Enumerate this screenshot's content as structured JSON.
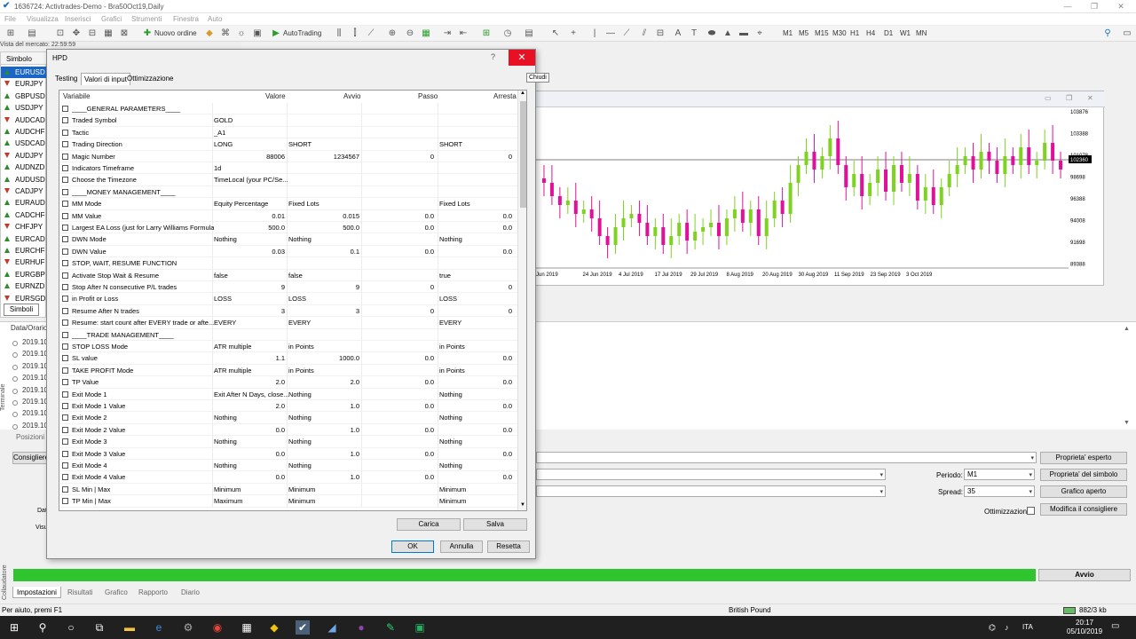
{
  "window": {
    "title": "1636724: Activtrades-Demo - Bra50Oct19,Daily"
  },
  "menu": [
    "File",
    "Visualizza",
    "Inserisci",
    "Grafici",
    "Strumenti",
    "Finestra",
    "Auto"
  ],
  "toolbar": {
    "new_order": "Nuovo ordine",
    "autotrading": "AutoTrading",
    "timeframes": [
      "M1",
      "M5",
      "M15",
      "M30",
      "H1",
      "H4",
      "D1",
      "W1",
      "MN"
    ]
  },
  "market_watch": {
    "header": "Vista del mercato: 22:59:59",
    "column": "Simbolo",
    "symbols": [
      "EURUSD",
      "EURJPY",
      "GBPUSD",
      "USDJPY",
      "AUDCAD",
      "AUDCHF",
      "USDCAD",
      "AUDJPY",
      "AUDNZD",
      "AUDUSD",
      "CADJPY",
      "EURAUD",
      "CADCHF",
      "CHFJPY",
      "EURCAD",
      "EURCHF",
      "EURHUF",
      "EURGBP",
      "EURNZD",
      "EURSGD"
    ],
    "selected": "EURUSD",
    "tab": "Simboli",
    "colors": {
      "selected_bg": "#1a66c8",
      "up": "#2d8a2d",
      "down": "#c0392b"
    }
  },
  "dialog": {
    "title": "HPD",
    "help": "?",
    "close_tooltip": "Chiudi",
    "tabs": [
      "Testing",
      "Valori di input",
      "Ottimizzazione"
    ],
    "active_tab": "Valori di input",
    "columns": [
      "Variabile",
      "Valore",
      "Avvio",
      "Passo",
      "Arresta"
    ],
    "rows": [
      [
        "____GENERAL PARAMETERS____",
        "",
        "",
        "",
        ""
      ],
      [
        "Traded Symbol",
        "GOLD",
        "",
        "",
        ""
      ],
      [
        "Tactic",
        "_A1",
        "",
        "",
        ""
      ],
      [
        "Trading Direction",
        "LONG",
        "SHORT",
        "",
        "SHORT"
      ],
      [
        "Magic Number",
        "88006",
        "1234567",
        "0",
        "0"
      ],
      [
        "Indicators Timeframe",
        "1d",
        "",
        "",
        ""
      ],
      [
        "Choose the Timezone",
        "TimeLocal (your PC/Se...",
        "",
        "",
        ""
      ],
      [
        "____MONEY MANAGEMENT____",
        "",
        "",
        "",
        ""
      ],
      [
        "MM Mode",
        "Equity Percentage",
        "Fixed Lots",
        "",
        "Fixed Lots"
      ],
      [
        "MM Value",
        "0.01",
        "0.015",
        "0.0",
        "0.0"
      ],
      [
        "Largest EA Loss (just for Larry Williams Formula)",
        "500.0",
        "500.0",
        "0.0",
        "0.0"
      ],
      [
        "DWN Mode",
        "Nothing",
        "Nothing",
        "",
        "Nothing"
      ],
      [
        "DWN Value",
        "0.03",
        "0.1",
        "0.0",
        "0.0"
      ],
      [
        "STOP, WAIT, RESUME FUNCTION",
        "",
        "",
        "",
        ""
      ],
      [
        "Activate Stop Wait & Resume",
        "false",
        "false",
        "",
        "true"
      ],
      [
        "Stop After N consecutive P/L trades",
        "9",
        "9",
        "0",
        "0"
      ],
      [
        "in Profit or Loss",
        "LOSS",
        "LOSS",
        "",
        "LOSS"
      ],
      [
        "Resume After N trades",
        "3",
        "3",
        "0",
        "0"
      ],
      [
        "Resume: start count after EVERY trade or afte...",
        "EVERY",
        "EVERY",
        "",
        "EVERY"
      ],
      [
        "____TRADE MANAGEMENT____",
        "",
        "",
        "",
        ""
      ],
      [
        "STOP LOSS Mode",
        "ATR multiple",
        "in Points",
        "",
        "in Points"
      ],
      [
        "SL value",
        "1.1",
        "1000.0",
        "0.0",
        "0.0"
      ],
      [
        "TAKE PROFIT Mode",
        "ATR multiple",
        "in Points",
        "",
        "in Points"
      ],
      [
        "TP Value",
        "2.0",
        "2.0",
        "0.0",
        "0.0"
      ],
      [
        "Exit Mode 1",
        "Exit After N Days, close...",
        "Nothing",
        "",
        "Nothing"
      ],
      [
        "Exit Mode 1 Value",
        "2.0",
        "1.0",
        "0.0",
        "0.0"
      ],
      [
        "Exit Mode 2",
        "Nothing",
        "Nothing",
        "",
        "Nothing"
      ],
      [
        "Exit Mode 2 Value",
        "0.0",
        "1.0",
        "0.0",
        "0.0"
      ],
      [
        "Exit Mode 3",
        "Nothing",
        "Nothing",
        "",
        "Nothing"
      ],
      [
        "Exit Mode 3 Value",
        "0.0",
        "1.0",
        "0.0",
        "0.0"
      ],
      [
        "Exit Mode 4",
        "Nothing",
        "Nothing",
        "",
        "Nothing"
      ],
      [
        "Exit Mode 4 Value",
        "0.0",
        "1.0",
        "0.0",
        "0.0"
      ],
      [
        "SL Min | Max",
        "Minimum",
        "Minimum",
        "",
        "Minimum"
      ],
      [
        "TP Min | Max",
        "Maximum",
        "Minimum",
        "",
        "Minimum"
      ]
    ],
    "buttons": {
      "load": "Carica",
      "save": "Salva",
      "ok": "OK",
      "cancel": "Annulla",
      "reset": "Resetta"
    }
  },
  "chart": {
    "prices": [
      "103876",
      "103388",
      "101078",
      "98698",
      "96388",
      "94008",
      "91698",
      "89388"
    ],
    "current": "102360",
    "dates": [
      "Jun 2019",
      "24 Jun 2019",
      "4 Jul 2019",
      "17 Jul 2019",
      "29 Jul 2019",
      "8 Aug 2019",
      "20 Aug 2019",
      "30 Aug 2019",
      "11 Sep 2019",
      "23 Sep 2019",
      "3 Oct 2019"
    ],
    "closes": [
      35,
      34,
      31,
      29,
      30,
      27,
      28,
      26,
      22,
      20,
      24,
      26,
      27,
      25,
      22,
      24,
      20,
      22,
      25,
      21,
      23,
      24,
      25,
      22,
      26,
      28,
      25,
      28,
      22,
      26,
      30,
      27,
      34,
      38,
      41,
      37,
      40,
      44,
      38,
      33,
      36,
      31,
      34,
      37,
      32,
      38,
      34,
      36,
      30,
      33,
      29,
      33,
      36,
      38,
      40,
      37,
      41,
      39,
      36,
      40,
      38,
      42,
      38,
      39,
      43,
      39,
      37
    ],
    "colors": {
      "up": "#7ed321",
      "down": "#e0109a",
      "line": "#000000"
    }
  },
  "terminal": {
    "header": "Data/Orario",
    "rows": [
      "2019.10",
      "2019.10",
      "2019.10",
      "2019.10",
      "2019.10",
      "2019.10",
      "2019.10",
      "2019.10"
    ],
    "side_labels": {
      "terminal": "Terminale",
      "positions": "Posizioni",
      "tester": "Collaudatore"
    }
  },
  "tester": {
    "expert_label": "Consigliere",
    "date_label": "Dat",
    "visual_label": "Visu",
    "period_label": "Periodo:",
    "period_value": "M1",
    "spread_label": "Spread:",
    "spread_value": "35",
    "optimization_label": "Ottimizzazione",
    "buttons": [
      "Proprieta' esperto",
      "Proprieta' del simbolo",
      "Grafico aperto",
      "Modifica il consigliere"
    ],
    "start": "Avvio",
    "progress": 1.0,
    "tabs": [
      "Impostazioni",
      "Risultati",
      "Grafico",
      "Rapporto",
      "Diario"
    ],
    "active_tab": "Impostazioni"
  },
  "status": {
    "help": "Per aiuto, premi F1",
    "symbol": "British Pound",
    "traffic": "882/3 kb"
  },
  "taskbar": {
    "lang": "ITA",
    "time": "20:17",
    "date": "05/10/2019"
  }
}
